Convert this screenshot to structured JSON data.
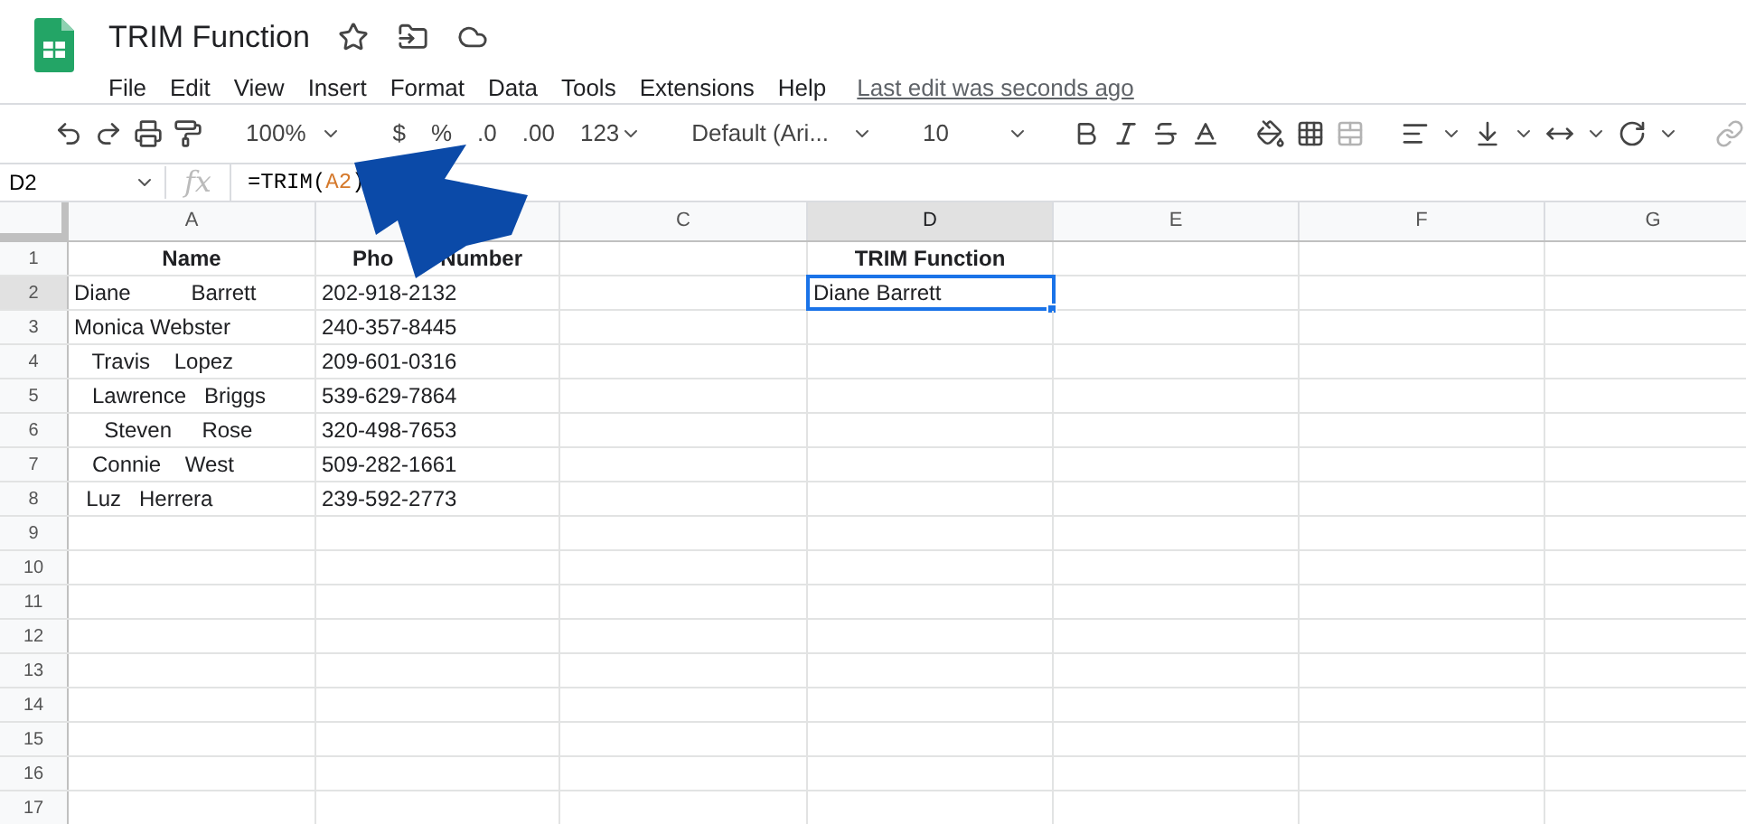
{
  "document": {
    "title": "TRIM Function",
    "last_edit": "Last edit was seconds ago"
  },
  "menu": [
    "File",
    "Edit",
    "View",
    "Insert",
    "Format",
    "Data",
    "Tools",
    "Extensions",
    "Help"
  ],
  "toolbar": {
    "zoom": "100%",
    "currency": "$",
    "percent": "%",
    "decrease_decimal": ".0",
    "increase_decimal": ".00",
    "number_format": "123",
    "font": "Default (Ari...",
    "font_size": "10"
  },
  "formula_bar": {
    "name_box": "D2",
    "fx": "fx",
    "formula_start": "=TRIM(",
    "formula_ref": "A2",
    "formula_end": ")"
  },
  "columns": [
    {
      "label": "A",
      "selected": false
    },
    {
      "selected": false
    },
    {
      "label": "C",
      "selected": false
    },
    {
      "label": "D",
      "selected": true
    },
    {
      "label": "E",
      "selected": false
    },
    {
      "label": "F",
      "selected": false
    },
    {
      "label": "G",
      "selected": false
    }
  ],
  "rows": [
    {
      "number": "1",
      "selected": false,
      "cells": [
        "Name",
        [
          "Pho",
          "Number"
        ],
        "",
        "TRIM Function"
      ]
    },
    {
      "number": "2",
      "selected": true,
      "cells": [
        "Diane          Barrett",
        "202-918-2132",
        "",
        "Diane Barrett"
      ]
    },
    {
      "number": "3",
      "selected": false,
      "cells": [
        "Monica Webster",
        "240-357-8445",
        "",
        ""
      ]
    },
    {
      "number": "4",
      "selected": false,
      "cells": [
        "   Travis    Lopez",
        "209-601-0316",
        "",
        ""
      ]
    },
    {
      "number": "5",
      "selected": false,
      "cells": [
        "   Lawrence   Briggs",
        "539-629-7864",
        "",
        ""
      ]
    },
    {
      "number": "6",
      "selected": false,
      "cells": [
        "     Steven     Rose",
        "320-498-7653",
        "",
        ""
      ]
    },
    {
      "number": "7",
      "selected": false,
      "cells": [
        "   Connie    West",
        "509-282-1661",
        "",
        ""
      ]
    },
    {
      "number": "8",
      "selected": false,
      "cells": [
        "  Luz   Herrera",
        "239-592-2773",
        "",
        ""
      ]
    },
    {
      "number": "9",
      "selected": false,
      "cells": []
    },
    {
      "number": "10",
      "selected": false,
      "cells": []
    },
    {
      "number": "11",
      "selected": false,
      "cells": []
    },
    {
      "number": "12",
      "selected": false,
      "cells": []
    },
    {
      "number": "13",
      "selected": false,
      "cells": []
    },
    {
      "number": "14",
      "selected": false,
      "cells": []
    },
    {
      "number": "15",
      "selected": false,
      "cells": []
    },
    {
      "number": "16",
      "selected": false,
      "cells": []
    },
    {
      "number": "17",
      "selected": false,
      "cells": []
    }
  ]
}
